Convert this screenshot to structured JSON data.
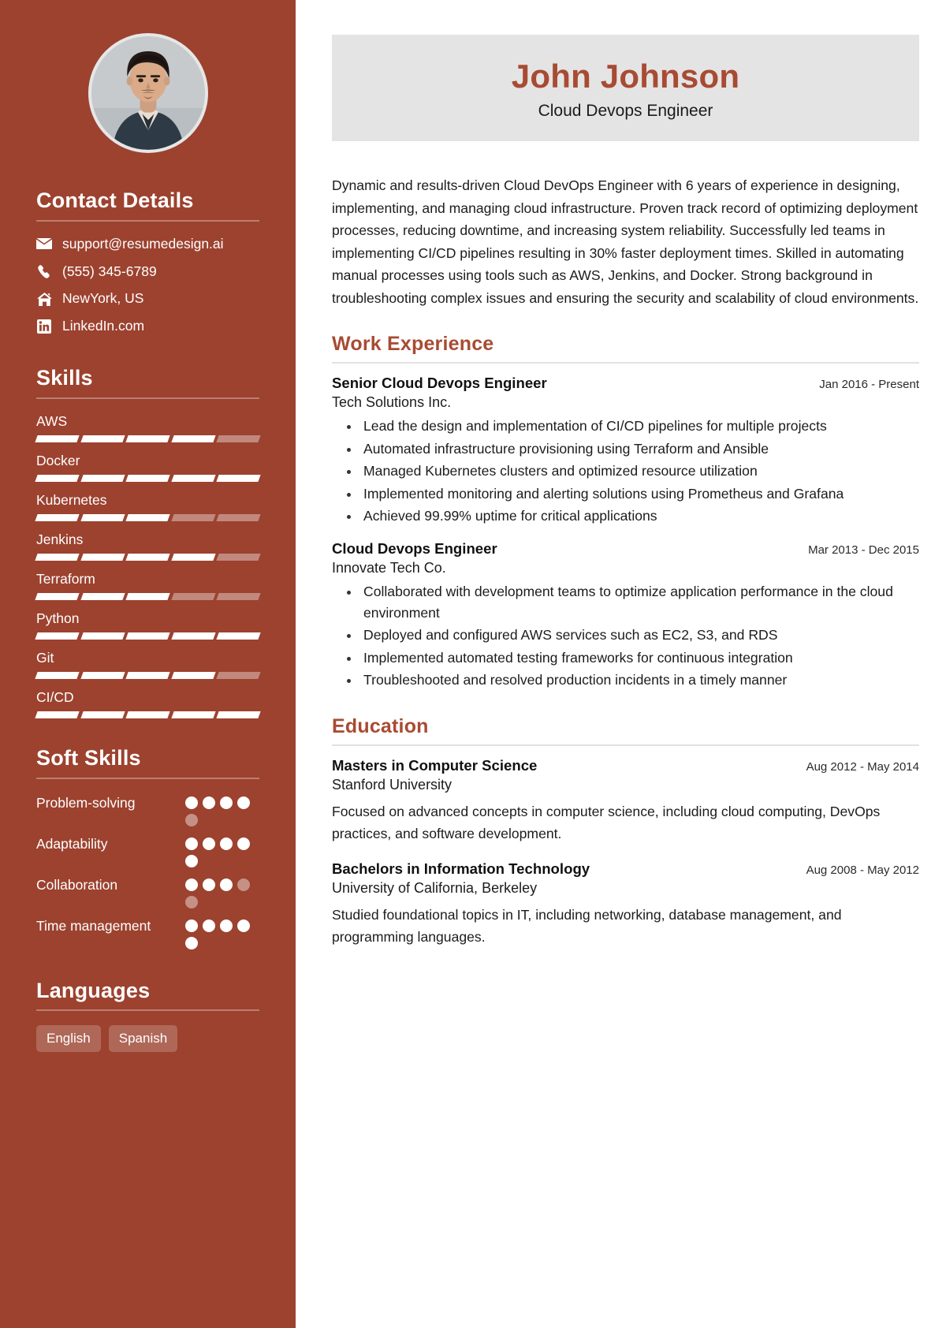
{
  "header": {
    "name": "John Johnson",
    "role": "Cloud Devops Engineer"
  },
  "colors": {
    "sidebar_bg": "#9c422f",
    "accent": "#a84b33",
    "name_card_bg": "#e4e4e4",
    "body_text": "#1c1c1c"
  },
  "sidebar": {
    "avatar": "profile-photo",
    "contact": {
      "heading": "Contact Details",
      "items": [
        {
          "icon": "envelope-icon",
          "value": "support@resumedesign.ai"
        },
        {
          "icon": "phone-icon",
          "value": "(555) 345-6789"
        },
        {
          "icon": "home-icon",
          "value": "NewYork, US"
        },
        {
          "icon": "linkedin-icon",
          "value": "LinkedIn.com"
        }
      ]
    },
    "skills": {
      "heading": "Skills",
      "max": 5,
      "items": [
        {
          "name": "AWS",
          "level": 4
        },
        {
          "name": "Docker",
          "level": 5
        },
        {
          "name": "Kubernetes",
          "level": 3
        },
        {
          "name": "Jenkins",
          "level": 4
        },
        {
          "name": "Terraform",
          "level": 3
        },
        {
          "name": "Python",
          "level": 5
        },
        {
          "name": "Git",
          "level": 4
        },
        {
          "name": "CI/CD",
          "level": 5
        }
      ]
    },
    "soft_skills": {
      "heading": "Soft Skills",
      "max": 5,
      "items": [
        {
          "name": "Problem-solving",
          "level": 4
        },
        {
          "name": "Adaptability",
          "level": 5
        },
        {
          "name": "Collaboration",
          "level": 3
        },
        {
          "name": "Time management",
          "level": 5
        }
      ]
    },
    "languages": {
      "heading": "Languages",
      "items": [
        "English",
        "Spanish"
      ]
    }
  },
  "main": {
    "summary": "Dynamic and results-driven Cloud DevOps Engineer with 6 years of experience in designing, implementing, and managing cloud infrastructure. Proven track record of optimizing deployment processes, reducing downtime, and increasing system reliability. Successfully led teams in implementing CI/CD pipelines resulting in 30% faster deployment times. Skilled in automating manual processes using tools such as AWS, Jenkins, and Docker. Strong background in troubleshooting complex issues and ensuring the security and scalability of cloud environments.",
    "work": {
      "heading": "Work Experience",
      "items": [
        {
          "title": "Senior Cloud Devops Engineer",
          "date": "Jan 2016 - Present",
          "org": "Tech Solutions Inc.",
          "bullets": [
            "Lead the design and implementation of CI/CD pipelines for multiple projects",
            "Automated infrastructure provisioning using Terraform and Ansible",
            "Managed Kubernetes clusters and optimized resource utilization",
            "Implemented monitoring and alerting solutions using Prometheus and Grafana",
            "Achieved 99.99% uptime for critical applications"
          ]
        },
        {
          "title": "Cloud Devops Engineer",
          "date": "Mar 2013 - Dec 2015",
          "org": "Innovate Tech Co.",
          "bullets": [
            "Collaborated with development teams to optimize application performance in the cloud environment",
            "Deployed and configured AWS services such as EC2, S3, and RDS",
            "Implemented automated testing frameworks for continuous integration",
            "Troubleshooted and resolved production incidents in a timely manner"
          ]
        }
      ]
    },
    "education": {
      "heading": "Education",
      "items": [
        {
          "title": "Masters in Computer Science",
          "date": "Aug 2012 - May 2014",
          "org": "Stanford University",
          "desc": "Focused on advanced concepts in computer science, including cloud computing, DevOps practices, and software development."
        },
        {
          "title": "Bachelors in Information Technology",
          "date": "Aug 2008 - May 2012",
          "org": "University of California, Berkeley",
          "desc": "Studied foundational topics in IT, including networking, database management, and programming languages."
        }
      ]
    }
  }
}
